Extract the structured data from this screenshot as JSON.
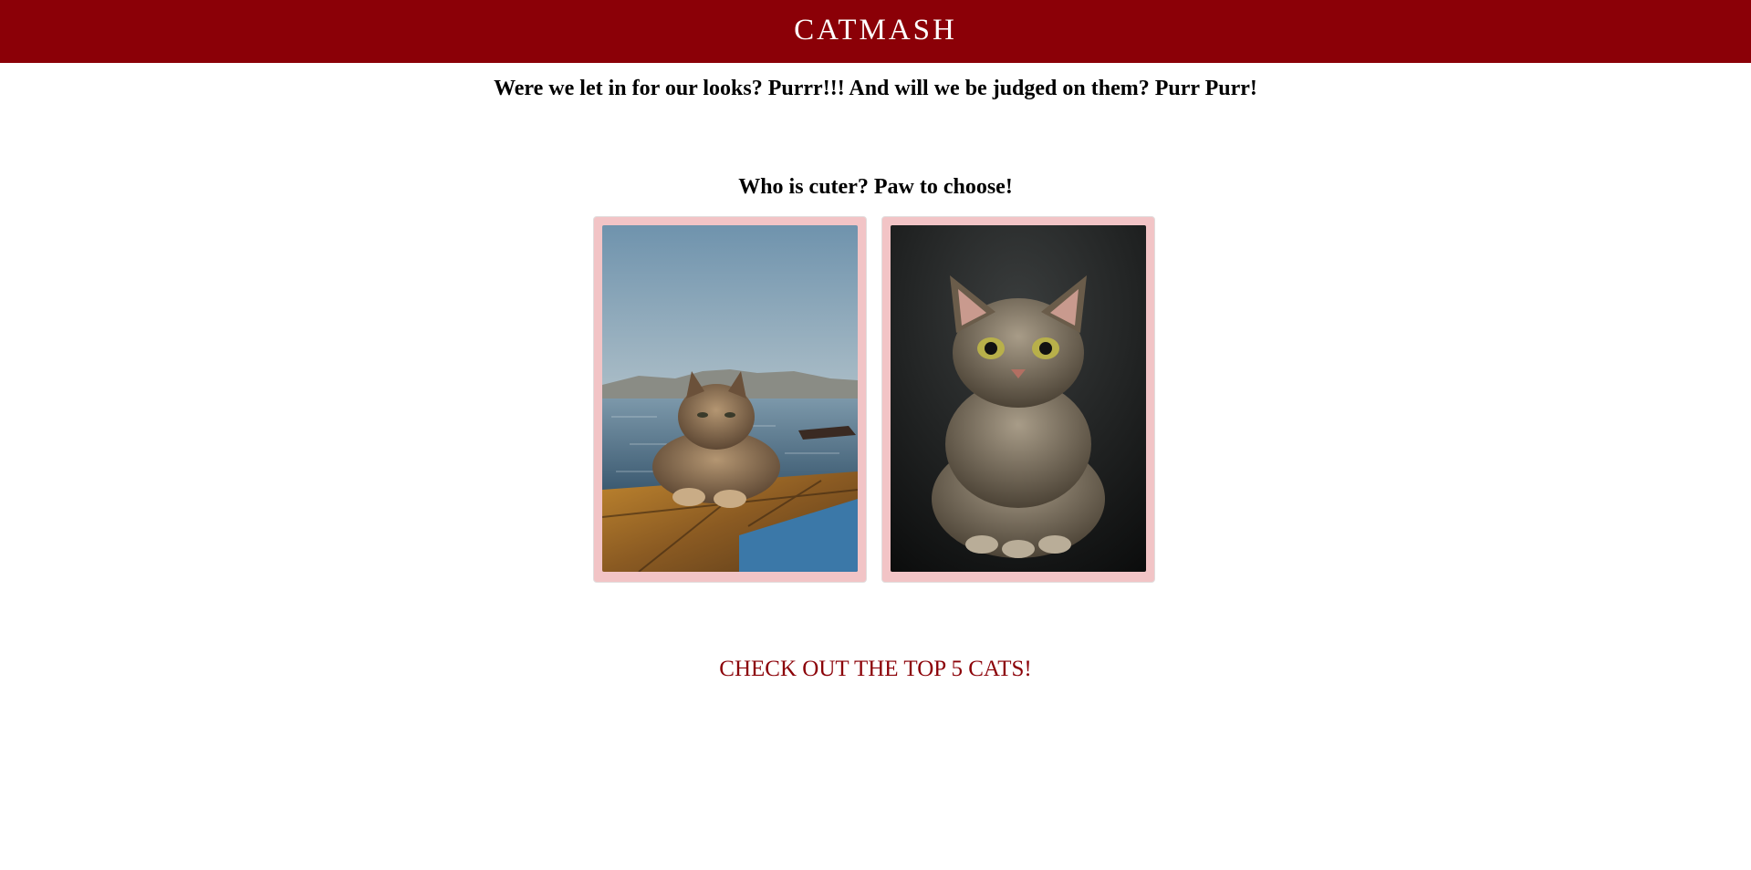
{
  "header": {
    "title": "CATMASH",
    "background_color": "#8b0007"
  },
  "tagline": "Were we let in for our looks? Purrr!!! And will we be judged on them? Purr Purr!",
  "vote": {
    "prompt": "Who is cuter? Paw to choose!",
    "candidates": [
      {
        "image": "tabby-cat-on-dock-by-sea-photo"
      },
      {
        "image": "tabby-kitten-on-black-background-photo"
      }
    ],
    "card_color": "#f2c4c6"
  },
  "cta": {
    "label": "CHECK OUT THE TOP 5 CATS!",
    "color": "#8b0007"
  }
}
